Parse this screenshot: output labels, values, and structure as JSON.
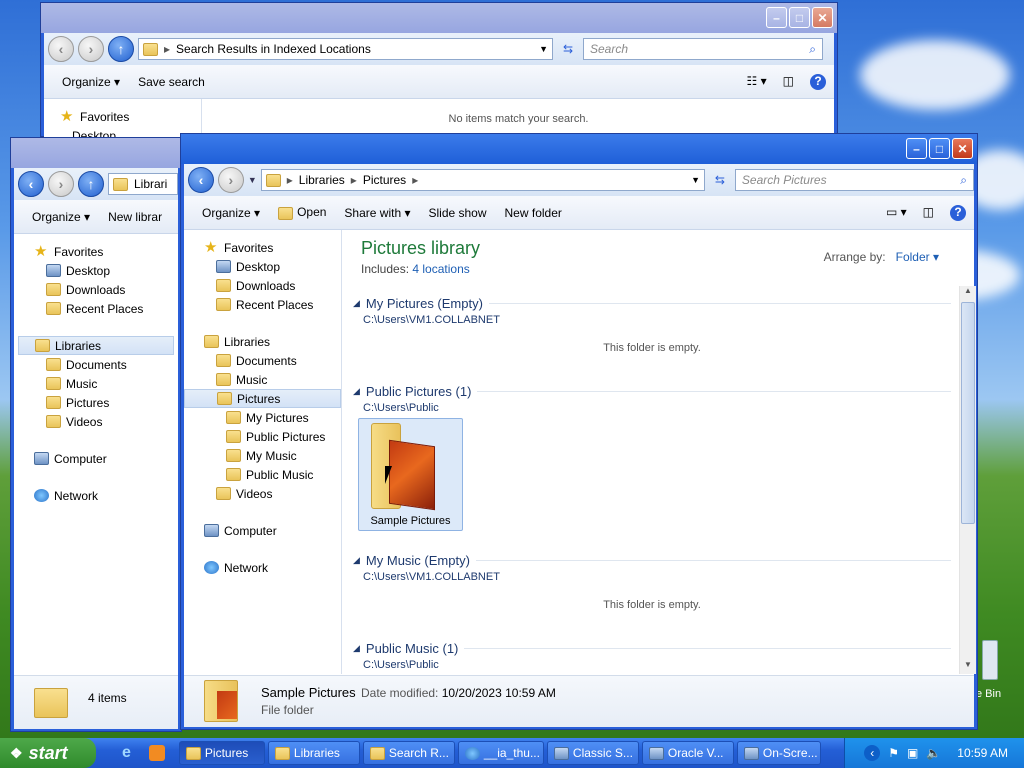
{
  "desktop": {
    "recycle_bin_label": "e Bin"
  },
  "search_window": {
    "address": "Search Results in Indexed Locations",
    "search_placeholder": "Search",
    "toolbar": {
      "organize": "Organize",
      "save_search": "Save search"
    },
    "nav": {
      "favorites": "Favorites",
      "desktop": "Desktop"
    },
    "message": "No items match your search."
  },
  "libraries_window": {
    "address": "Librari",
    "toolbar": {
      "organize": "Organize",
      "new_library": "New librar"
    },
    "nav": {
      "favorites": "Favorites",
      "desktop": "Desktop",
      "downloads": "Downloads",
      "recent": "Recent Places",
      "libraries": "Libraries",
      "documents": "Documents",
      "music": "Music",
      "pictures": "Pictures",
      "videos": "Videos",
      "computer": "Computer",
      "network": "Network"
    },
    "status": "4 items"
  },
  "pictures_window": {
    "breadcrumb": [
      "Libraries",
      "Pictures"
    ],
    "search_placeholder": "Search Pictures",
    "toolbar": {
      "organize": "Organize",
      "open": "Open",
      "share_with": "Share with",
      "slide_show": "Slide show",
      "new_folder": "New folder"
    },
    "nav": {
      "favorites": "Favorites",
      "desktop": "Desktop",
      "downloads": "Downloads",
      "recent": "Recent Places",
      "libraries": "Libraries",
      "documents": "Documents",
      "music": "Music",
      "pictures": "Pictures",
      "my_pictures": "My Pictures",
      "public_pictures": "Public Pictures",
      "my_music": "My Music",
      "public_music": "Public Music",
      "videos": "Videos",
      "computer": "Computer",
      "network": "Network"
    },
    "library_title": "Pictures library",
    "includes_label": "Includes:",
    "includes_link": "4 locations",
    "arrange_label": "Arrange by:",
    "arrange_value": "Folder",
    "groups": [
      {
        "title": "My Pictures (Empty)",
        "path": "C:\\Users\\VM1.COLLABNET",
        "empty": "This folder is empty."
      },
      {
        "title": "Public Pictures (1)",
        "path": "C:\\Users\\Public",
        "item": "Sample Pictures"
      },
      {
        "title": "My Music (Empty)",
        "path": "C:\\Users\\VM1.COLLABNET",
        "empty": "This folder is empty."
      },
      {
        "title": "Public Music (1)",
        "path": "C:\\Users\\Public"
      }
    ],
    "details": {
      "name": "Sample Pictures",
      "date_label": "Date modified:",
      "date_value": "10/20/2023 10:59 AM",
      "type": "File folder"
    }
  },
  "taskbar": {
    "start": "start",
    "items": [
      "Pictures",
      "Libraries",
      "Search R...",
      "__ia_thu...",
      "Classic S...",
      "Oracle V...",
      "On-Scre..."
    ],
    "clock": "10:59 AM"
  },
  "colors": {
    "accent": "#2a5fd9",
    "library_title": "#1e7a3a",
    "link": "#1e5fb4"
  }
}
